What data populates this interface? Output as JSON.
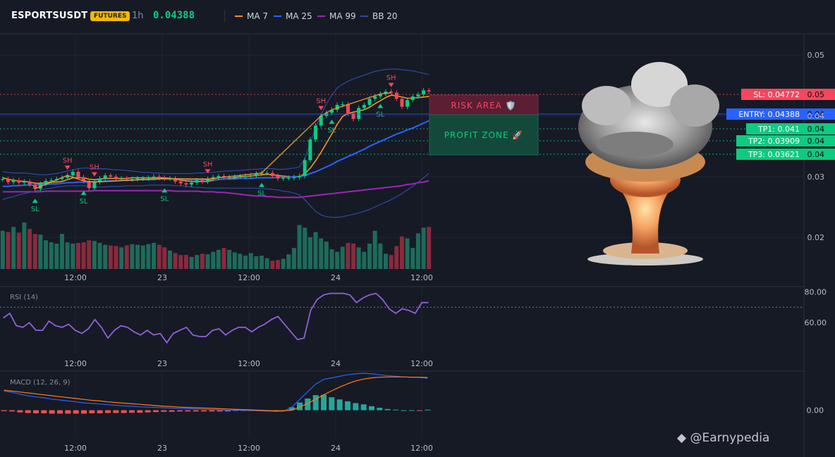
{
  "header": {
    "symbol": "ESPORTSUSDT",
    "badge": "FUTURES",
    "interval": "1h",
    "price": "0.04388",
    "indicators": [
      {
        "label": "MA 7",
        "color": "#f7931a"
      },
      {
        "label": "MA 25",
        "color": "#2962ff"
      },
      {
        "label": "MA 99",
        "color": "#9c27b0"
      },
      {
        "label": "BB 20",
        "color": "#2f4aa0"
      }
    ]
  },
  "zones": {
    "risk_label": "RISK AREA 🛡️",
    "profit_label": "PROFIT ZONE 🚀"
  },
  "levels": [
    {
      "label": "SL: 0.04772",
      "axis_label": "0.05",
      "value": 0.04772,
      "color": "#f6465d"
    },
    {
      "label": "ENTRY: 0.04388",
      "axis_label": "0.04",
      "value": 0.04388,
      "color": "#2962ff"
    },
    {
      "label": "TP1: 0.041",
      "axis_label": "0.04",
      "value": 0.041,
      "color": "#0ecb81"
    },
    {
      "label": "TP2: 0.03909",
      "axis_label": "0.04",
      "value": 0.03909,
      "color": "#0ecb81"
    },
    {
      "label": "TP3: 0.03621",
      "axis_label": "0.04",
      "value": 0.03621,
      "color": "#0ecb81"
    }
  ],
  "markers": {
    "high": "SH",
    "low": "SL"
  },
  "watermark": "◆ @Earnypedia",
  "chart_data": [
    {
      "type": "candlestick",
      "title": "ESPORTSUSDT",
      "x_ticks": [
        "12:00",
        "23",
        "12:00",
        "24",
        "12:00"
      ],
      "y_ticks": [
        "0.05",
        "0.04",
        "0.03",
        "0.02"
      ],
      "ylim": [
        0.0148,
        0.0535
      ],
      "close": [
        0.0296,
        0.0291,
        0.0294,
        0.029,
        0.0292,
        0.0287,
        0.028,
        0.0288,
        0.0293,
        0.0294,
        0.0296,
        0.0298,
        0.0302,
        0.0308,
        0.0299,
        0.0293,
        0.0281,
        0.0291,
        0.0297,
        0.0302,
        0.03,
        0.0297,
        0.0297,
        0.0296,
        0.0296,
        0.0297,
        0.0297,
        0.0298,
        0.03,
        0.0298,
        0.0297,
        0.0297,
        0.0292,
        0.0289,
        0.0287,
        0.029,
        0.0294,
        0.0292,
        0.0296,
        0.0299,
        0.0301,
        0.0299,
        0.0299,
        0.03,
        0.03,
        0.0301,
        0.0302,
        0.0305,
        0.0306,
        0.0306,
        0.0301,
        0.0297,
        0.0298,
        0.0298,
        0.0299,
        0.0301,
        0.0327,
        0.0361,
        0.0384,
        0.04,
        0.0405,
        0.041,
        0.0418,
        0.0419,
        0.0404,
        0.0395,
        0.0413,
        0.0418,
        0.0428,
        0.0432,
        0.0436,
        0.044,
        0.0438,
        0.0428,
        0.0415,
        0.0426,
        0.0432,
        0.0435,
        0.0442,
        0.044
      ],
      "volume": [
        60,
        58,
        66,
        57,
        73,
        63,
        55,
        54,
        45,
        42,
        40,
        55,
        42,
        40,
        41,
        42,
        45,
        44,
        41,
        38,
        37,
        36,
        34,
        37,
        39,
        38,
        37,
        39,
        41,
        38,
        34,
        29,
        25,
        22,
        22,
        19,
        22,
        24,
        23,
        27,
        30,
        33,
        30,
        26,
        24,
        21,
        25,
        20,
        21,
        17,
        13,
        14,
        16,
        23,
        33,
        69,
        65,
        50,
        58,
        48,
        43,
        31,
        27,
        35,
        41,
        40,
        34,
        27,
        40,
        60,
        40,
        24,
        22,
        36,
        51,
        48,
        33,
        56,
        65,
        66
      ],
      "series": [
        {
          "name": "MA 7",
          "values": [
            0.0298,
            0.0296,
            0.0294,
            0.0293,
            0.0292,
            0.0291,
            0.0289,
            0.0289,
            0.029,
            0.0291,
            0.0291,
            0.0292,
            0.0295,
            0.0298,
            0.0298,
            0.0298,
            0.0296,
            0.0295,
            0.0296,
            0.0297,
            0.0297,
            0.0297,
            0.0297,
            0.0297,
            0.0298,
            0.0298,
            0.0298,
            0.0298,
            0.0298,
            0.0298,
            0.0298,
            0.0297,
            0.0296,
            0.0294,
            0.0293,
            0.0292,
            0.0292,
            0.0292,
            0.0292,
            0.0294,
            0.0295,
            0.0296,
            0.0297,
            0.0298,
            0.03,
            0.03,
            0.0301,
            0.0302,
            0.0303,
            0.0304,
            0.0303,
            0.0302,
            0.0301,
            0.03,
            0.0299,
            0.03,
            0.0305,
            0.0314,
            0.0326,
            0.034,
            0.0355,
            0.037,
            0.0386,
            0.0399,
            0.0404,
            0.0406,
            0.0408,
            0.041,
            0.0414,
            0.042,
            0.0425,
            0.043,
            0.0434,
            0.0433,
            0.0431,
            0.0429,
            0.0429,
            0.043,
            0.0431,
            0.0432
          ]
        },
        {
          "name": "MA 25",
          "values": [
            0.0284,
            0.0284,
            0.0285,
            0.0285,
            0.0286,
            0.0286,
            0.0286,
            0.0287,
            0.0287,
            0.0288,
            0.0288,
            0.0289,
            0.029,
            0.029,
            0.0291,
            0.0291,
            0.0291,
            0.0292,
            0.0292,
            0.0293,
            0.0293,
            0.0293,
            0.0294,
            0.0294,
            0.0294,
            0.0295,
            0.0295,
            0.0295,
            0.0295,
            0.0296,
            0.0296,
            0.0296,
            0.0296,
            0.0296,
            0.0295,
            0.0295,
            0.0295,
            0.0295,
            0.0295,
            0.0295,
            0.0295,
            0.0296,
            0.0296,
            0.0296,
            0.0297,
            0.0297,
            0.0297,
            0.0298,
            0.0298,
            0.0298,
            0.0298,
            0.0299,
            0.0299,
            0.0299,
            0.03,
            0.03,
            0.0302,
            0.0305,
            0.0308,
            0.0312,
            0.0316,
            0.032,
            0.0325,
            0.0329,
            0.0333,
            0.0337,
            0.0341,
            0.0345,
            0.035,
            0.0354,
            0.0358,
            0.0362,
            0.0366,
            0.037,
            0.0373,
            0.0377,
            0.038,
            0.0384,
            0.0388,
            0.0392
          ]
        },
        {
          "name": "MA 99",
          "values": [
            0.0275,
            0.0275,
            0.0275,
            0.0275,
            0.0275,
            0.0275,
            0.0275,
            0.0275,
            0.0276,
            0.0276,
            0.0276,
            0.0276,
            0.0276,
            0.0276,
            0.0276,
            0.0276,
            0.0276,
            0.0277,
            0.0277,
            0.0277,
            0.0277,
            0.0277,
            0.0277,
            0.0277,
            0.0277,
            0.0277,
            0.0277,
            0.0277,
            0.0277,
            0.0277,
            0.0277,
            0.0277,
            0.0276,
            0.0276,
            0.0276,
            0.0276,
            0.0276,
            0.0275,
            0.0275,
            0.0275,
            0.0274,
            0.0274,
            0.0273,
            0.0272,
            0.0271,
            0.027,
            0.0269,
            0.0268,
            0.0268,
            0.0267,
            0.0267,
            0.0266,
            0.0266,
            0.0266,
            0.0266,
            0.0266,
            0.0267,
            0.0268,
            0.0269,
            0.027,
            0.0271,
            0.0272,
            0.0273,
            0.0274,
            0.0275,
            0.0276,
            0.0277,
            0.0278,
            0.0279,
            0.028,
            0.0281,
            0.0282,
            0.0283,
            0.0284,
            0.0285,
            0.0287,
            0.0288,
            0.029,
            0.0291,
            0.0293
          ]
        },
        {
          "name": "BB 20",
          "values": [
            0.0308,
            0.0307,
            0.0306,
            0.0306,
            0.0306,
            0.0305,
            0.0304,
            0.0303,
            0.0303,
            0.0304,
            0.0305,
            0.0307,
            0.0309,
            0.0311,
            0.0313,
            0.0314,
            0.0314,
            0.0313,
            0.0313,
            0.0313,
            0.0312,
            0.0311,
            0.0311,
            0.031,
            0.0309,
            0.0308,
            0.0307,
            0.0307,
            0.0306,
            0.0306,
            0.0305,
            0.0305,
            0.0305,
            0.0305,
            0.0305,
            0.0305,
            0.0306,
            0.0306,
            0.0307,
            0.0307,
            0.0308,
            0.0309,
            0.0309,
            0.031,
            0.031,
            0.0311,
            0.0312,
            0.0312,
            0.0313,
            0.0313,
            0.0313,
            0.0312,
            0.0312,
            0.0313,
            0.0314,
            0.0316,
            0.033,
            0.0355,
            0.038,
            0.0402,
            0.042,
            0.0434,
            0.0446,
            0.0452,
            0.0457,
            0.0461,
            0.0464,
            0.0467,
            0.047,
            0.0473,
            0.0475,
            0.0476,
            0.0477,
            0.0477,
            0.0476,
            0.0475,
            0.0474,
            0.0472,
            0.047,
            0.0468
          ]
        },
        {
          "name": "BB 20 lower",
          "values": [
            0.0262,
            0.0265,
            0.0267,
            0.027,
            0.0272,
            0.0274,
            0.0276,
            0.0278,
            0.028,
            0.0281,
            0.0283,
            0.0284,
            0.0285,
            0.0285,
            0.0285,
            0.0285,
            0.0284,
            0.0283,
            0.0283,
            0.0283,
            0.0284,
            0.0284,
            0.0284,
            0.0285,
            0.0285,
            0.0285,
            0.0285,
            0.0286,
            0.0286,
            0.0286,
            0.0286,
            0.0286,
            0.0285,
            0.0285,
            0.0284,
            0.0283,
            0.0282,
            0.0282,
            0.0281,
            0.0281,
            0.0281,
            0.0281,
            0.0281,
            0.0281,
            0.0281,
            0.0281,
            0.0281,
            0.0281,
            0.028,
            0.028,
            0.0279,
            0.0278,
            0.0276,
            0.0275,
            0.0273,
            0.027,
            0.0262,
            0.0252,
            0.0243,
            0.0237,
            0.0234,
            0.0233,
            0.0233,
            0.0234,
            0.0236,
            0.0238,
            0.024,
            0.0243,
            0.0246,
            0.025,
            0.0254,
            0.0258,
            0.0262,
            0.0267,
            0.0272,
            0.0278,
            0.0284,
            0.0291,
            0.0298,
            0.0305
          ]
        }
      ],
      "swing_highs": [
        12,
        17,
        38,
        59,
        72
      ],
      "swing_lows": [
        6,
        15,
        30,
        48,
        61,
        70
      ]
    },
    {
      "type": "line",
      "title": "RSI (14)",
      "x_ticks": [
        "12:00",
        "23",
        "12:00",
        "24",
        "12:00"
      ],
      "y_ticks": [
        "80.00",
        "60.00"
      ],
      "ylim": [
        40,
        82
      ],
      "series": [
        {
          "name": "RSI (14)",
          "values": [
            63,
            66,
            58,
            57,
            60,
            55,
            55,
            61,
            58,
            57,
            59,
            55,
            53,
            56,
            62,
            57,
            50,
            55,
            58,
            57,
            54,
            52,
            55,
            52,
            53,
            47,
            53,
            55,
            57,
            52,
            51,
            51,
            55,
            56,
            52,
            55,
            57,
            57,
            54,
            57,
            59,
            62,
            64,
            59,
            54,
            49,
            50,
            68,
            75,
            78,
            79,
            79,
            79,
            78,
            73,
            76,
            78,
            79,
            75,
            69,
            66,
            69,
            68,
            66,
            73,
            73
          ]
        }
      ],
      "levels": [
        70
      ]
    },
    {
      "type": "bar",
      "title": "MACD (12, 26, 9)",
      "x_ticks": [
        "12:00",
        "23",
        "12:00",
        "24",
        "12:00"
      ],
      "y_ticks": [
        "0.00"
      ],
      "ylim": [
        -0.0009,
        0.0012
      ],
      "series": [
        {
          "name": "MACD",
          "values": [
            0.00062,
            0.00058,
            0.00052,
            0.00047,
            0.00043,
            0.0004,
            0.00036,
            0.00033,
            0.0003,
            0.00027,
            0.00024,
            0.00022,
            0.0002,
            0.00018,
            0.00016,
            0.00014,
            0.00013,
            0.00011,
            0.0001,
            9e-05,
            8e-05,
            7e-05,
            6e-05,
            5e-05,
            4e-05,
            3e-05,
            2e-05,
            1e-05,
            0.0,
            1e-05,
            0.0,
            -1e-05,
            -2e-05,
            -3e-05,
            -4e-05,
            -3e-05,
            0.0001,
            0.00035,
            0.0006,
            0.00085,
            0.001,
            0.00105,
            0.0011,
            0.00115,
            0.00118,
            0.0012,
            0.00118,
            0.00115,
            0.00112,
            0.0011,
            0.00108,
            0.00107,
            0.00106,
            0.00104
          ]
        },
        {
          "name": "Signal",
          "values": [
            0.00065,
            0.00062,
            0.00059,
            0.00056,
            0.00053,
            0.0005,
            0.00047,
            0.00044,
            0.00041,
            0.00038,
            0.00035,
            0.00032,
            0.0003,
            0.00027,
            0.00025,
            0.00023,
            0.00021,
            0.00019,
            0.00017,
            0.00015,
            0.00013,
            0.00012,
            0.0001,
            9e-05,
            8e-05,
            7e-05,
            6e-05,
            5e-05,
            4e-05,
            3e-05,
            2e-05,
            1e-05,
            0.0,
            -1e-05,
            -2e-05,
            -2e-05,
            0.0,
            0.0001,
            0.00022,
            0.00036,
            0.0005,
            0.00063,
            0.00075,
            0.00086,
            0.00095,
            0.00101,
            0.00105,
            0.00107,
            0.00108,
            0.00108,
            0.00108,
            0.00107,
            0.00107,
            0.00106
          ]
        },
        {
          "name": "Histogram",
          "values": [
            -3e-05,
            -4e-05,
            -7e-05,
            -9e-05,
            -0.0001,
            -0.0001,
            -0.00011,
            -0.00011,
            -0.00011,
            -0.00011,
            -0.00011,
            -0.0001,
            -0.0001,
            -9e-05,
            -9e-05,
            -9e-05,
            -8e-05,
            -8e-05,
            -7e-05,
            -6e-05,
            -5e-05,
            -5e-05,
            -4e-05,
            -4e-05,
            -4e-05,
            -4e-05,
            -4e-05,
            -4e-05,
            -4e-05,
            -2e-05,
            -2e-05,
            -2e-05,
            -2e-05,
            -2e-05,
            -2e-05,
            -1e-05,
            0.0001,
            0.00025,
            0.00038,
            0.00049,
            0.0005,
            0.00042,
            0.00035,
            0.00029,
            0.00023,
            0.00019,
            0.00013,
            8e-05,
            4e-05,
            2e-05,
            0.0,
            0.0,
            -1e-05,
            2e-05
          ]
        }
      ]
    }
  ]
}
